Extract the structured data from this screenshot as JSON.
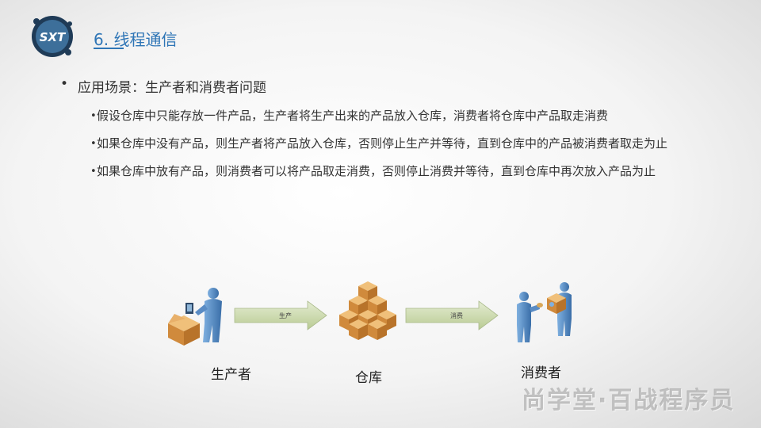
{
  "logo": {
    "text": "SXT"
  },
  "slide_title": "6. 线程通信",
  "bullets": {
    "main": "应用场景：生产者和消费者问题",
    "items": [
      "假设仓库中只能存放一件产品，生产者将生产出来的产品放入仓库，消费者将仓库中产品取走消费",
      "如果仓库中没有产品，则生产者将产品放入仓库，否则停止生产并等待，直到仓库中的产品被消费者取走为止",
      "如果仓库中放有产品，则消费者可以将产品取走消费，否则停止消费并等待，直到仓库中再次放入产品为止"
    ]
  },
  "diagram": {
    "arrow1_label": "生产",
    "arrow2_label": "消费",
    "producer_label": "生产者",
    "warehouse_label": "仓库",
    "consumer_label": "消费者"
  },
  "watermark": "尚学堂·百战程序员",
  "colors": {
    "title": "#2e75b6",
    "figure": "#4a7fb8",
    "box": "#d89a4a",
    "arrow": "#c8d7a8"
  }
}
